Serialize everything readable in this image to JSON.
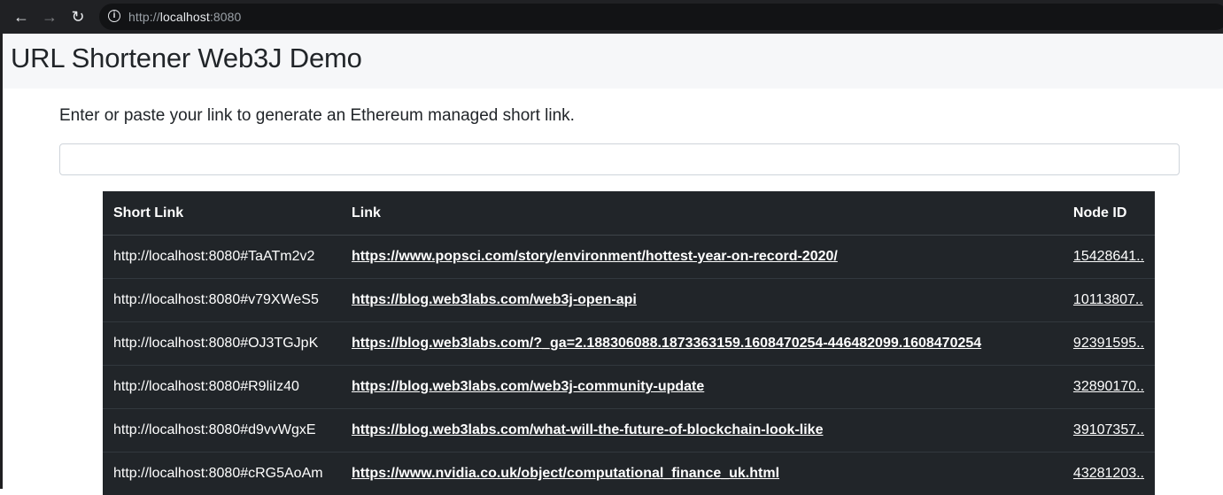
{
  "browser": {
    "url_scheme": "http://",
    "url_host": "localhost",
    "url_port": ":8080"
  },
  "page": {
    "title": "URL Shortener Web3J Demo",
    "prompt": "Enter or paste your link to generate an Ethereum managed short link.",
    "input_value": ""
  },
  "table": {
    "headers": [
      "Short Link",
      "Link",
      "Node ID"
    ],
    "rows": [
      {
        "short": "http://localhost:8080#TaATm2v2",
        "link": "https://www.popsci.com/story/environment/hottest-year-on-record-2020/",
        "node": "15428641.."
      },
      {
        "short": "http://localhost:8080#v79XWeS5",
        "link": "https://blog.web3labs.com/web3j-open-api",
        "node": "10113807.."
      },
      {
        "short": "http://localhost:8080#OJ3TGJpK",
        "link": "https://blog.web3labs.com/?_ga=2.188306088.1873363159.1608470254-446482099.1608470254",
        "node": "92391595.."
      },
      {
        "short": "http://localhost:8080#R9liIz40",
        "link": "https://blog.web3labs.com/web3j-community-update",
        "node": "32890170.."
      },
      {
        "short": "http://localhost:8080#d9vvWgxE",
        "link": "https://blog.web3labs.com/what-will-the-future-of-blockchain-look-like",
        "node": "39107357.."
      },
      {
        "short": "http://localhost:8080#cRG5AoAm",
        "link": "https://www.nvidia.co.uk/object/computational_finance_uk.html",
        "node": "43281203.."
      }
    ]
  }
}
